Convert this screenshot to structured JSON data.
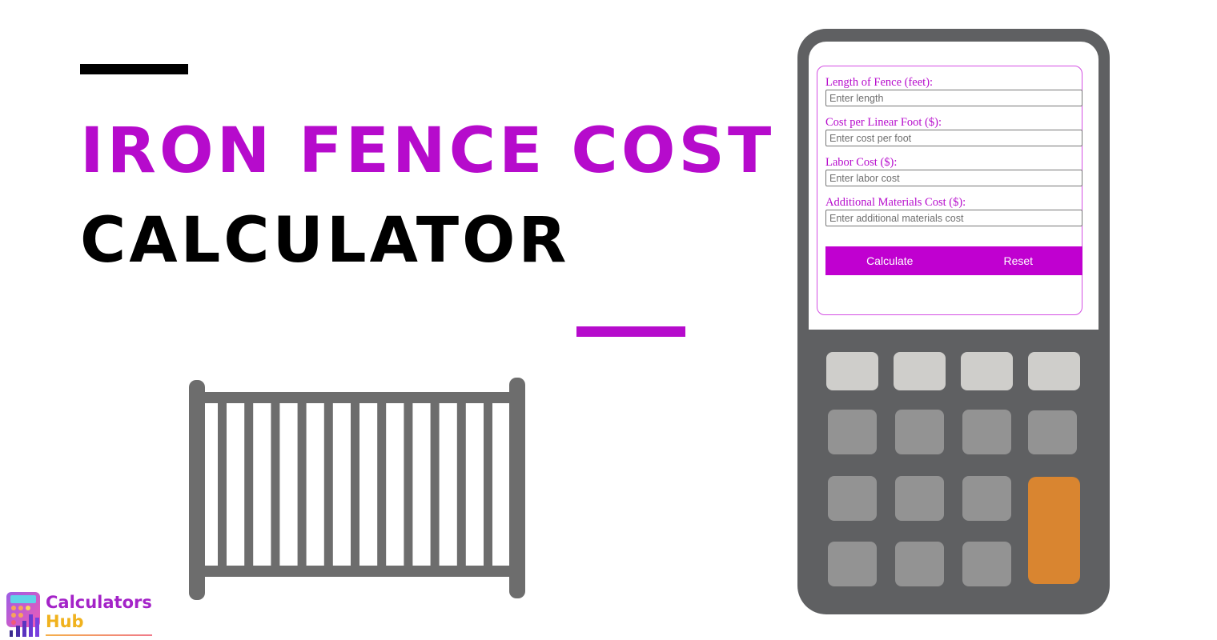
{
  "hero": {
    "title_line1": "IRON FENCE COST",
    "title_line2": "CALCULATOR"
  },
  "calculator": {
    "fields": [
      {
        "label": "Length of Fence (feet):",
        "placeholder": "Enter length",
        "value": ""
      },
      {
        "label": "Cost per Linear Foot ($):",
        "placeholder": "Enter cost per foot",
        "value": ""
      },
      {
        "label": "Labor Cost ($):",
        "placeholder": "Enter labor cost",
        "value": ""
      },
      {
        "label": "Additional Materials Cost ($):",
        "placeholder": "Enter additional materials cost",
        "value": ""
      }
    ],
    "buttons": {
      "calculate": "Calculate",
      "reset": "Reset"
    }
  },
  "logo": {
    "line1": "Calculators",
    "line2": "Hub"
  },
  "colors": {
    "accent": "#b60bcc",
    "button": "#c000d0",
    "device_body": "#5f6062",
    "key_light": "#cfcecb",
    "key_gray": "#939393",
    "key_orange": "#d98530",
    "fence": "#6d6d6d"
  }
}
